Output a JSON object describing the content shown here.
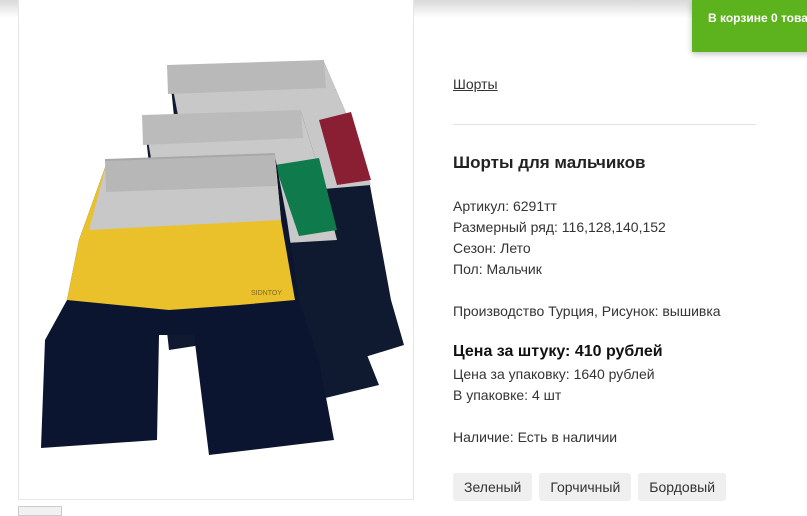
{
  "cart": {
    "label": "В корзине 0 това"
  },
  "product": {
    "breadcrumb": "Шорты",
    "title": "Шорты для мальчиков",
    "details": {
      "article": "Артикул: 6291тт",
      "sizes": "Размерный ряд: 116,128,140,152",
      "season": "Сезон: Лето",
      "gender": "Пол: Мальчик"
    },
    "production": "Производство Турция, Рисунок: вышивка",
    "price_per_item": "Цена за штуку: 410 рублей",
    "price_per_pack": "Цена за упаковку: 1640 рублей",
    "pack_count": "В упаковке: 4 шт",
    "availability": "Наличие: Есть в наличии",
    "colors": [
      "Зеленый",
      "Горчичный",
      "Бордовый"
    ],
    "image_brand_text": "SIDNTOY"
  }
}
